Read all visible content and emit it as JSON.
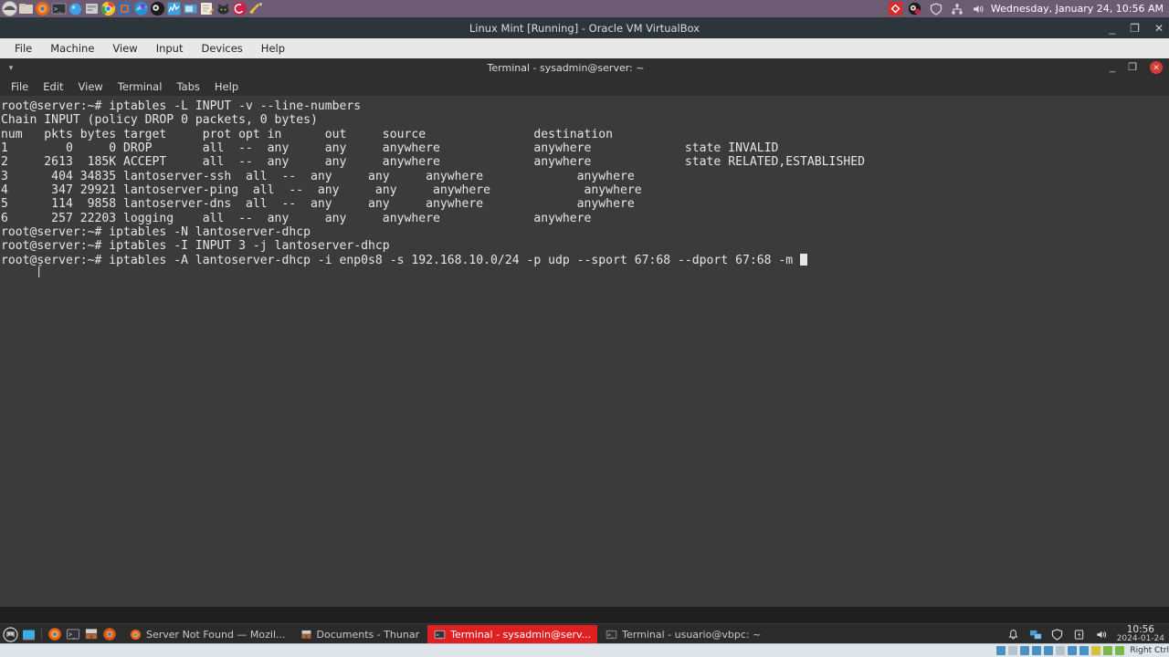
{
  "host_dock": {
    "icons": [
      {
        "name": "mint-menu-icon",
        "glyph": "◓"
      },
      {
        "name": "file-manager-icon",
        "glyph": "🗀"
      },
      {
        "name": "firefox-icon",
        "glyph": "●"
      },
      {
        "name": "terminal-icon",
        "glyph": "▣"
      },
      {
        "name": "water-drop-icon",
        "glyph": "●"
      },
      {
        "name": "archive-manager-icon",
        "glyph": "▤"
      },
      {
        "name": "chrome-icon",
        "glyph": "◉"
      },
      {
        "name": "virtualbox-icon",
        "glyph": "▢"
      },
      {
        "name": "edge-icon",
        "glyph": "◐"
      },
      {
        "name": "obs-icon",
        "glyph": "◎"
      },
      {
        "name": "system-monitor-icon",
        "glyph": "▥"
      },
      {
        "name": "screenshot-icon",
        "glyph": "▭"
      },
      {
        "name": "text-editor-icon",
        "glyph": "✎"
      },
      {
        "name": "cat-icon",
        "glyph": "⊶"
      },
      {
        "name": "debian-icon",
        "glyph": "◉"
      },
      {
        "name": "tools-icon",
        "glyph": "✂"
      }
    ],
    "tray": {
      "record_icon": "record-indicator-icon",
      "obs_icon": "obs-tray-icon",
      "shield_icon": "shield-tray-icon",
      "network_icon": "network-tray-icon",
      "volume_icon": "volume-tray-icon",
      "clock": "Wednesday, January 24, 10:56 AM"
    }
  },
  "vbox_window": {
    "title": "Linux Mint [Running] - Oracle VM VirtualBox",
    "menu": [
      "File",
      "Machine",
      "View",
      "Input",
      "Devices",
      "Help"
    ],
    "controls": {
      "minimize": "_",
      "restore": "❐",
      "close": "✕"
    },
    "status": {
      "host_key": "Right Ctrl"
    }
  },
  "terminal": {
    "title": "Terminal - sysadmin@server: ~",
    "menu": [
      "File",
      "Edit",
      "View",
      "Terminal",
      "Tabs",
      "Help"
    ],
    "controls": {
      "minimize": "_",
      "restore": "❐",
      "close": "✕"
    },
    "prompt": "root@server:~#",
    "lines": [
      "root@server:~# iptables -L INPUT -v --line-numbers",
      "Chain INPUT (policy DROP 0 packets, 0 bytes)",
      "num   pkts bytes target     prot opt in      out     source               destination         ",
      "1        0     0 DROP       all  --  any     any     anywhere             anywhere             state INVALID",
      "2     2613  185K ACCEPT     all  --  any     any     anywhere             anywhere             state RELATED,ESTABLISHED",
      "3      404 34835 lantoserver-ssh  all  --  any     any     anywhere             anywhere            ",
      "4      347 29921 lantoserver-ping  all  --  any     any     anywhere             anywhere            ",
      "5      114  9858 lantoserver-dns  all  --  any     any     anywhere             anywhere            ",
      "6      257 22203 logging    all  --  any     any     anywhere             anywhere            ",
      "root@server:~# iptables -N lantoserver-dhcp",
      "root@server:~# iptables -I INPUT 3 -j lantoserver-dhcp",
      "root@server:~# iptables -A lantoserver-dhcp -i enp0s8 -s 192.168.10.0/24 -p udp --sport 67:68 --dport 67:68 -m "
    ],
    "table": {
      "headers": [
        "num",
        "pkts",
        "bytes",
        "target",
        "prot",
        "opt",
        "in",
        "out",
        "source",
        "destination"
      ],
      "rows": [
        {
          "num": "1",
          "pkts": "0",
          "bytes": "0",
          "target": "DROP",
          "prot": "all",
          "opt": "--",
          "in": "any",
          "out": "any",
          "source": "anywhere",
          "destination": "anywhere",
          "extra": "state INVALID"
        },
        {
          "num": "2",
          "pkts": "2613",
          "bytes": "185K",
          "target": "ACCEPT",
          "prot": "all",
          "opt": "--",
          "in": "any",
          "out": "any",
          "source": "anywhere",
          "destination": "anywhere",
          "extra": "state RELATED,ESTABLISHED"
        },
        {
          "num": "3",
          "pkts": "404",
          "bytes": "34835",
          "target": "lantoserver-ssh",
          "prot": "all",
          "opt": "--",
          "in": "any",
          "out": "any",
          "source": "anywhere",
          "destination": "anywhere",
          "extra": ""
        },
        {
          "num": "4",
          "pkts": "347",
          "bytes": "29921",
          "target": "lantoserver-ping",
          "prot": "all",
          "opt": "--",
          "in": "any",
          "out": "any",
          "source": "anywhere",
          "destination": "anywhere",
          "extra": ""
        },
        {
          "num": "5",
          "pkts": "114",
          "bytes": "9858",
          "target": "lantoserver-dns",
          "prot": "all",
          "opt": "--",
          "in": "any",
          "out": "any",
          "source": "anywhere",
          "destination": "anywhere",
          "extra": ""
        },
        {
          "num": "6",
          "pkts": "257",
          "bytes": "22203",
          "target": "logging",
          "prot": "all",
          "opt": "--",
          "in": "any",
          "out": "any",
          "source": "anywhere",
          "destination": "anywhere",
          "extra": ""
        }
      ]
    },
    "chain_header": "Chain INPUT (policy DROP 0 packets, 0 bytes)",
    "colors": {
      "background": "#3b3b3b",
      "foreground": "#e6e6e6",
      "cursor": "#e8e8e8"
    }
  },
  "guest_taskbar": {
    "launchers": [
      {
        "name": "mint-menu-button",
        "glyph": "m"
      },
      {
        "name": "show-desktop-button",
        "glyph": "▭"
      }
    ],
    "quicklaunch": [
      {
        "name": "firefox-launcher-icon",
        "glyph": "●"
      },
      {
        "name": "terminal-launcher-icon",
        "glyph": "▣"
      },
      {
        "name": "thunar-launcher-icon",
        "glyph": "▥"
      },
      {
        "name": "firefox-dev-launcher-icon",
        "glyph": "●"
      }
    ],
    "tasks": [
      {
        "label": "Server Not Found — Mozil...",
        "icon": "firefox-window-icon",
        "active": false
      },
      {
        "label": "Documents - Thunar",
        "icon": "thunar-window-icon",
        "active": false
      },
      {
        "label": "Terminal - sysadmin@serv...",
        "icon": "terminal-window-icon",
        "active": true
      },
      {
        "label": "Terminal - usuario@vbpc: ~",
        "icon": "terminal-window-icon",
        "active": false
      }
    ],
    "tray": [
      {
        "name": "notifications-icon",
        "glyph": "🔔"
      },
      {
        "name": "network-icon",
        "glyph": "🖧"
      },
      {
        "name": "security-shield-icon",
        "glyph": "🛡"
      },
      {
        "name": "battery-icon",
        "glyph": "🔋"
      },
      {
        "name": "volume-icon",
        "glyph": "🔊"
      }
    ],
    "clock": {
      "time": "10:56",
      "date": "2024-01-24"
    }
  }
}
